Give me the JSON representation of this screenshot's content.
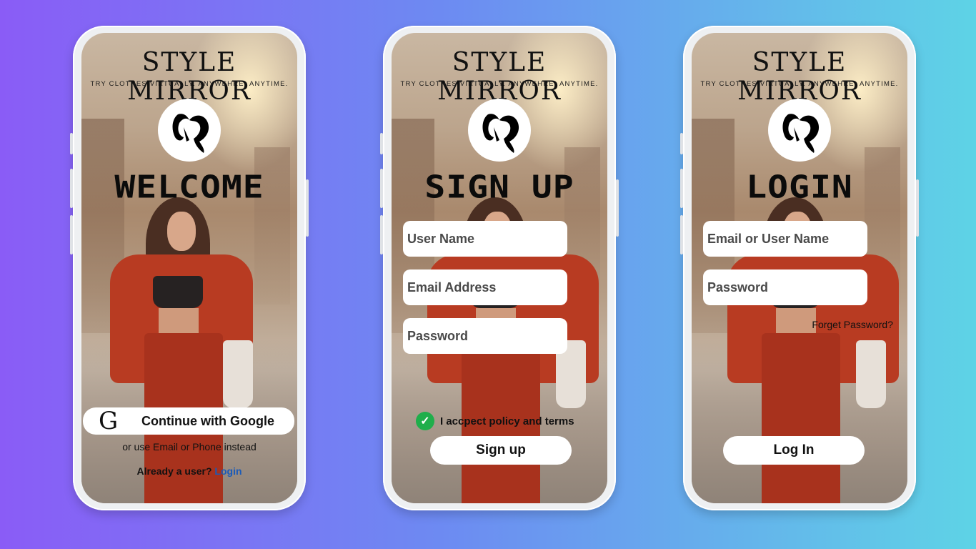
{
  "brand": {
    "title": "STYLE MIRROR",
    "tagline": "TRY CLOTHES VIRTUALLY. ANYWEHRE. ANYTIME."
  },
  "welcome": {
    "heading": "WELCOME",
    "google_button": "Continue with Google",
    "google_icon": "G",
    "alt_text": "or use Email or Phone instead",
    "already_user": "Already a user?",
    "login_link": "Login"
  },
  "signup": {
    "heading": "SIGN UP",
    "username_placeholder": "User Name",
    "email_placeholder": "Email Address",
    "password_placeholder": "Password",
    "terms_label": "I accpect policy and terms",
    "signup_button": "Sign up"
  },
  "login": {
    "heading": "LOGIN",
    "user_placeholder": "Email or User Name",
    "password_placeholder": "Password",
    "forgot_link": "Forget Password?",
    "login_button": "Log In"
  },
  "colors": {
    "link": "#1b5bb8",
    "check": "#1fae4b",
    "background_start": "#8a5cf6",
    "background_end": "#5ed3e6"
  }
}
